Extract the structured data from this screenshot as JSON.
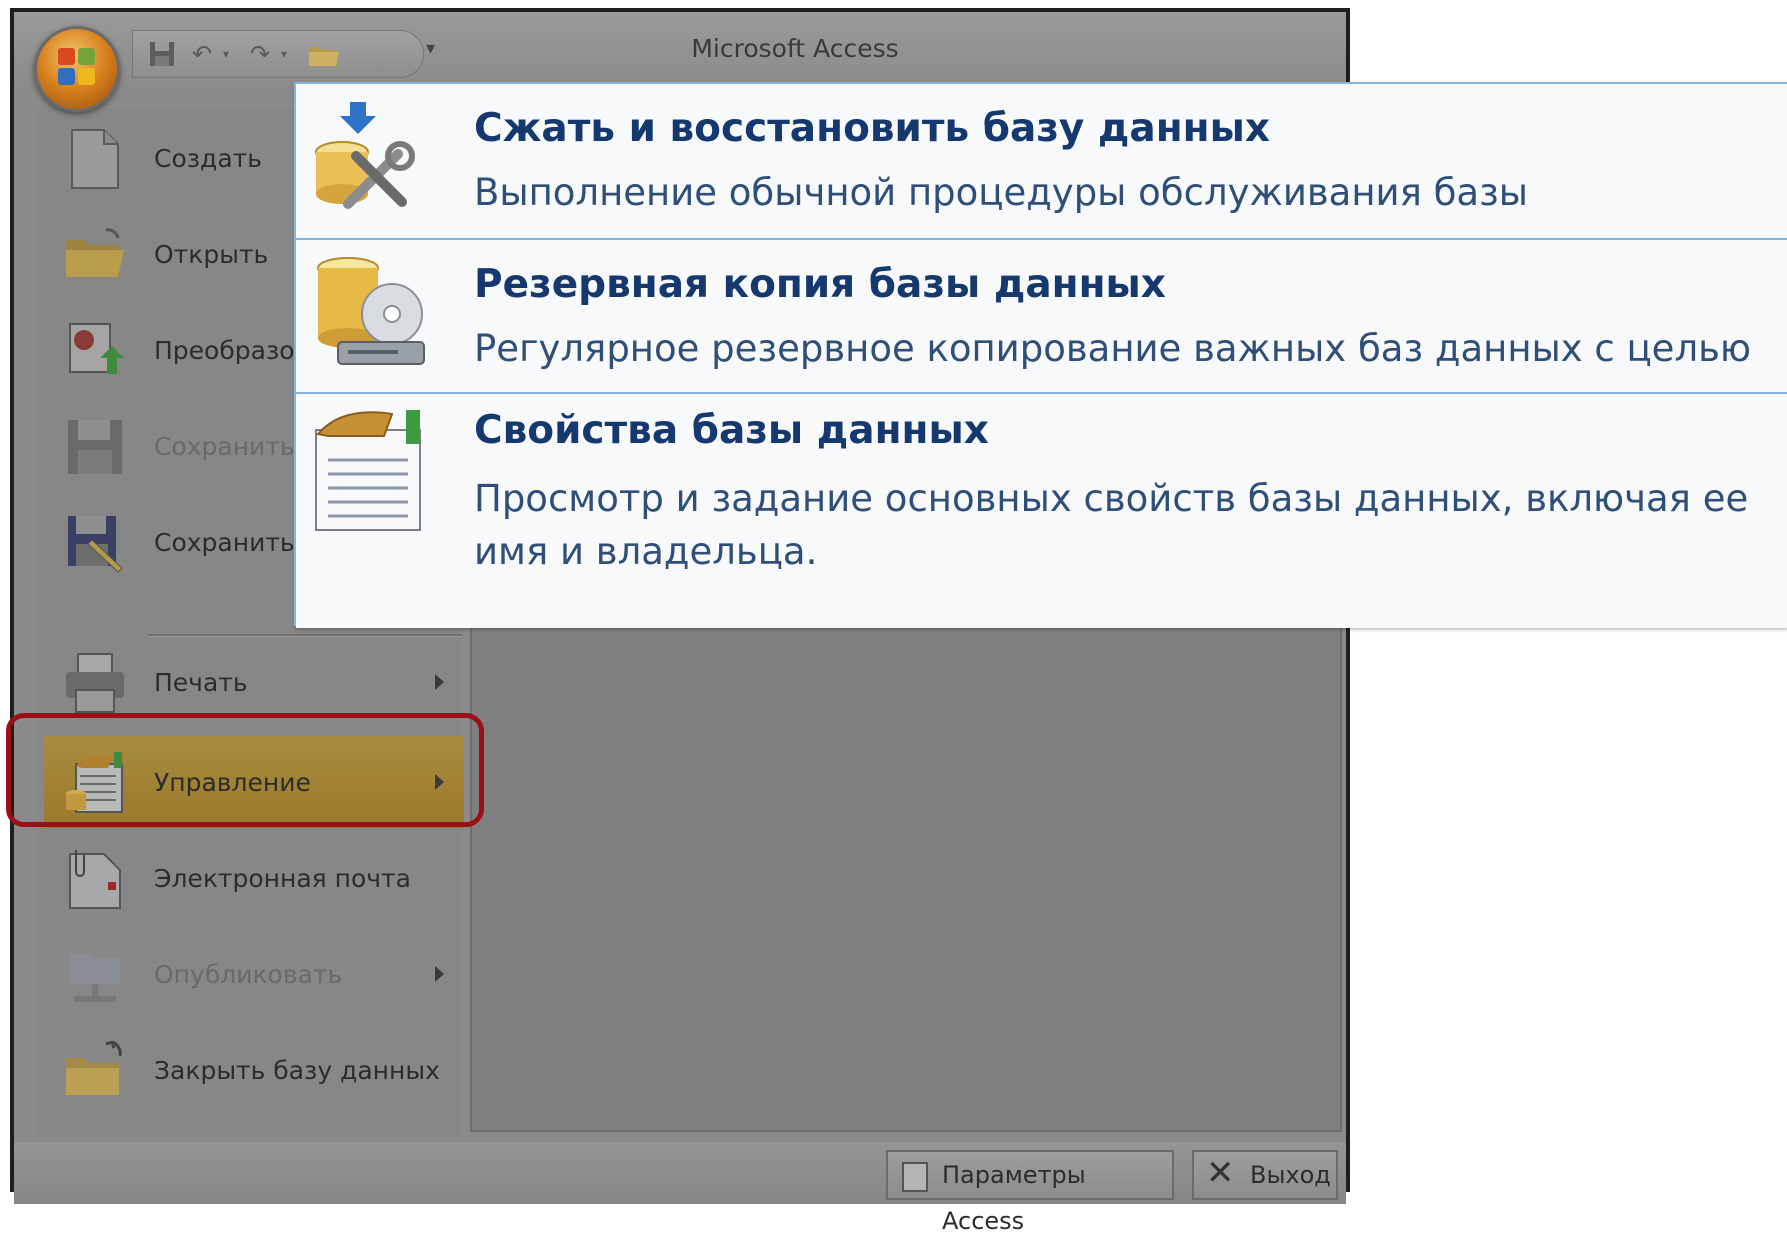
{
  "window": {
    "title": "Microsoft Access"
  },
  "menu": {
    "items": [
      {
        "label": "Создать",
        "icon": "new-document-icon"
      },
      {
        "label": "Открыть",
        "icon": "open-folder-icon"
      },
      {
        "label": "Преобразов",
        "icon": "convert-icon"
      },
      {
        "label": "Сохранить",
        "icon": "save-icon",
        "disabled": true
      },
      {
        "label": "Сохранить к",
        "icon": "save-as-icon"
      },
      {
        "label": "Печать",
        "icon": "printer-icon",
        "has_submenu": true
      },
      {
        "label": "Управление",
        "icon": "manage-icon",
        "has_submenu": true,
        "active": true
      },
      {
        "label": "Электронная почта",
        "icon": "email-icon"
      },
      {
        "label": "Опубликовать",
        "icon": "publish-icon",
        "has_submenu": true,
        "disabled": true
      },
      {
        "label": "Закрыть базу данных",
        "icon": "close-database-icon"
      }
    ]
  },
  "bottom": {
    "options_label": "Параметры Access",
    "exit_label": "Выход"
  },
  "submenu": {
    "items": [
      {
        "title": "Сжать и восстановить базу данных",
        "desc": "Выполнение обычной процедуры обслуживания базы",
        "icon": "compact-repair-icon"
      },
      {
        "title": "Резервная копия базы данных",
        "desc": "Регулярное резервное копирование важных баз данных с целью предотвращения потери данных.",
        "icon": "backup-database-icon"
      },
      {
        "title": "Свойства базы данных",
        "desc": "Просмотр и задание основных свойств базы данных, включая ее имя и владельца.",
        "icon": "database-properties-icon"
      }
    ]
  },
  "colors": {
    "highlight_border": "#9b0f17",
    "submenu_border": "#86b6e0",
    "submenu_title": "#15396e"
  }
}
